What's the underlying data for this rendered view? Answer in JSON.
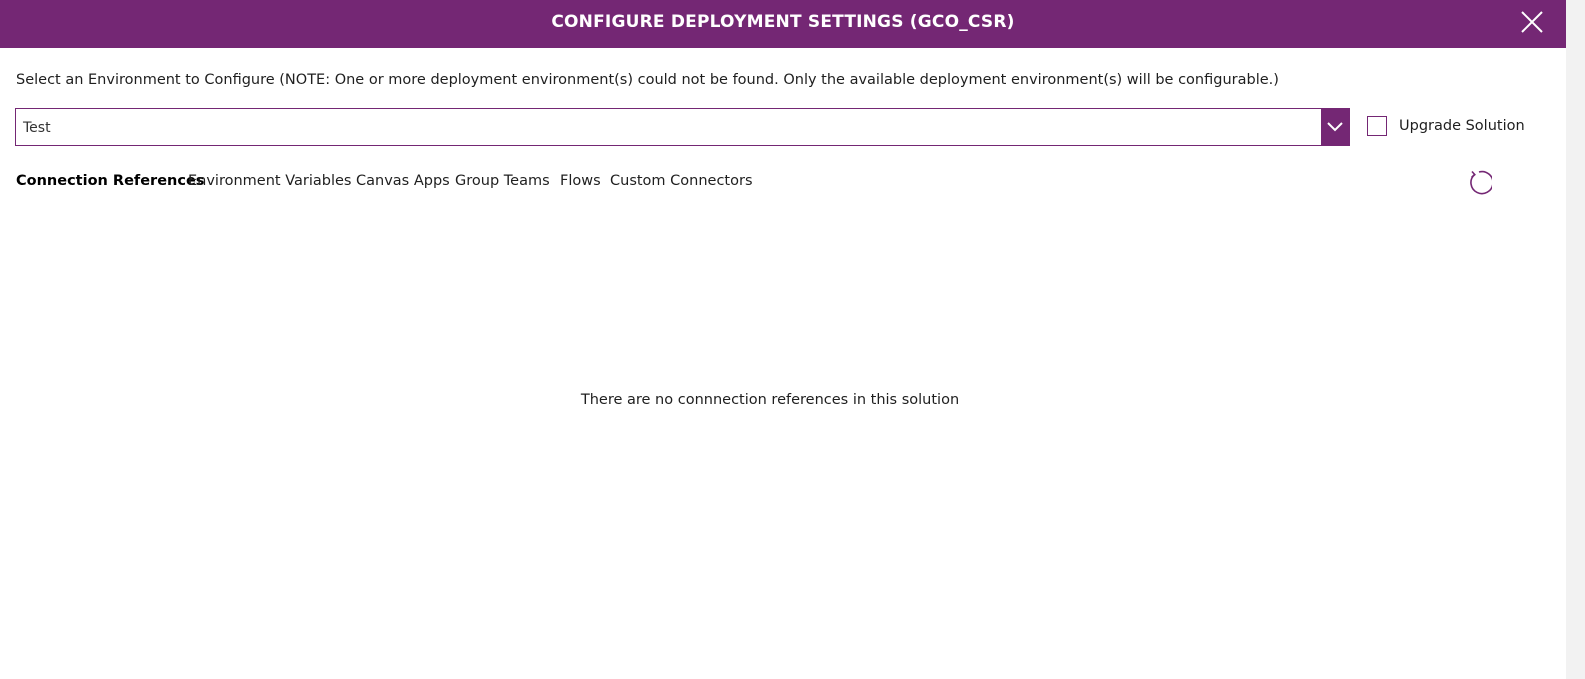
{
  "dialog": {
    "title": "CONFIGURE DEPLOYMENT SETTINGS (GCO_CSR)",
    "instruction": "Select an Environment to Configure (NOTE: One or more deployment environment(s) could not be found. Only the available deployment environment(s) will be configurable.)"
  },
  "environment_select": {
    "value": "Test"
  },
  "upgrade": {
    "label": "Upgrade Solution",
    "checked": false
  },
  "tabs": [
    {
      "label": "Connection References",
      "active": true
    },
    {
      "label": "Environment Variables",
      "active": false
    },
    {
      "label": "Canvas Apps",
      "active": false
    },
    {
      "label": "Group Teams",
      "active": false
    },
    {
      "label": "Flows",
      "active": false
    },
    {
      "label": "Custom Connectors",
      "active": false
    }
  ],
  "content": {
    "empty_message": "There are no connnection references in this solution"
  },
  "icons": {
    "close": "close-icon",
    "dropdown": "chevron-down-icon",
    "refresh": "refresh-icon"
  },
  "colors": {
    "accent": "#742774",
    "background": "#ffffff",
    "text": "#1f1f1f"
  }
}
